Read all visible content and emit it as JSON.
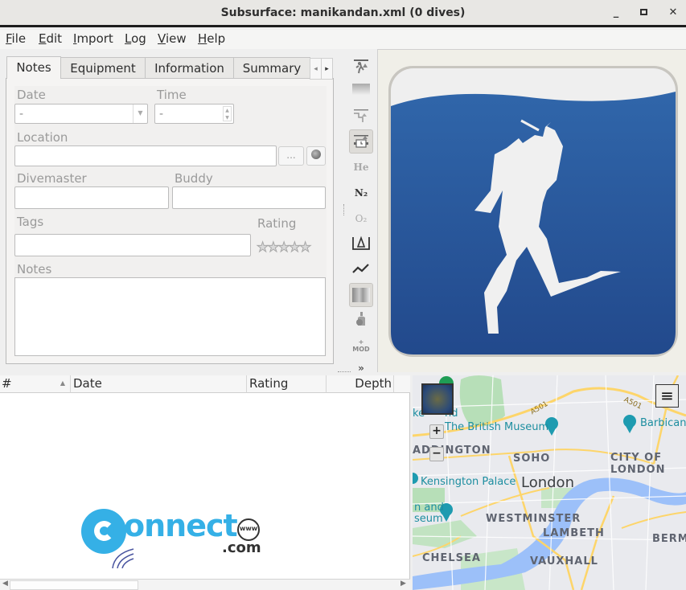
{
  "window": {
    "title": "Subsurface: manikandan.xml (0 dives)",
    "minimize_glyph": "_",
    "maximize_glyph": "□",
    "close_glyph": "✕"
  },
  "menu": {
    "items": [
      {
        "label": "File",
        "mnemonic": "F",
        "rest": "ile"
      },
      {
        "label": "Edit",
        "mnemonic": "E",
        "rest": "dit"
      },
      {
        "label": "Import",
        "mnemonic": "I",
        "rest": "mport"
      },
      {
        "label": "Log",
        "mnemonic": "L",
        "rest": "og"
      },
      {
        "label": "View",
        "mnemonic": "V",
        "rest": "iew"
      },
      {
        "label": "Help",
        "mnemonic": "H",
        "rest": "elp"
      }
    ]
  },
  "tabs": {
    "items": [
      {
        "label": "Notes",
        "active": true
      },
      {
        "label": "Equipment",
        "active": false
      },
      {
        "label": "Information",
        "active": false
      },
      {
        "label": "Summary",
        "active": false
      }
    ],
    "scroll_left": "◂",
    "scroll_right": "▸"
  },
  "notes_form": {
    "date_label": "Date",
    "date_value": "-",
    "time_label": "Time",
    "time_value": "-",
    "location_label": "Location",
    "location_value": "",
    "location_more_button": "...",
    "location_gps_icon": "globe-pin-icon",
    "divemaster_label": "Divemaster",
    "divemaster_value": "",
    "buddy_label": "Buddy",
    "buddy_value": "",
    "tags_label": "Tags",
    "tags_value": "",
    "rating_label": "Rating",
    "rating_stars": "★★★★★",
    "rating_value": 0,
    "rating_max": 5,
    "notes_label": "Notes",
    "notes_value": ""
  },
  "profile_toolbar": {
    "tools": [
      {
        "name": "ceiling-dc-icon",
        "text": "",
        "checked": false
      },
      {
        "name": "ceiling-gradient-icon",
        "text": "",
        "checked": false
      },
      {
        "name": "ceiling-calculated-icon",
        "text": "",
        "checked": false
      },
      {
        "name": "tissue-timer-icon",
        "text": "",
        "checked": true
      },
      {
        "name": "helium-icon",
        "text": "He",
        "checked": false
      },
      {
        "name": "nitrogen-icon",
        "text": "N₂",
        "checked": false
      },
      {
        "name": "oxygen-icon",
        "text": "O₂",
        "checked": false
      },
      {
        "name": "ruler-delta-icon",
        "text": "",
        "checked": false
      },
      {
        "name": "rate-graph-icon",
        "text": "",
        "checked": false
      },
      {
        "name": "heatmap-icon",
        "text": "",
        "checked": true
      },
      {
        "name": "tank-bar-icon",
        "text": "",
        "checked": false
      },
      {
        "name": "mod-icon",
        "text": "MOD",
        "checked": false
      },
      {
        "name": "more-chevron-icon",
        "text": "⌄",
        "checked": false
      }
    ]
  },
  "dive_list": {
    "columns": [
      {
        "label": "#",
        "sort": "▲"
      },
      {
        "label": "Date"
      },
      {
        "label": "Rating"
      },
      {
        "label": "Depth"
      }
    ],
    "rows": [],
    "watermark": {
      "main": "Connect",
      "sub": ".com",
      "www": "www"
    }
  },
  "map": {
    "labels": {
      "british_museum": "The British Museum",
      "barbican": "Barbican",
      "soho": "SOHO",
      "city": "CITY OF",
      "london_upper": "LONDON",
      "paddington": "ADDINGTON",
      "kensington_palace": "Kensington Palace",
      "london": "London",
      "museum_partial_1": "n and",
      "museum_partial_2": "seum",
      "westminster": "WESTMINSTER",
      "lambeth": "LAMBETH",
      "bermondsey": "BERM",
      "chelsea": "CHELSEA",
      "vauxhall": "VAUXHALL",
      "road_a501_1": "A501",
      "road_a501_2": "A501",
      "regents_partial": "ke",
      "regents_partial2": "nd"
    },
    "zoom_in": "+",
    "zoom_out": "−",
    "menu_glyph": "≡",
    "colors": {
      "land": "#e9eaee",
      "park": "#b7dfb8",
      "water": "#9cc0f9",
      "road": "#fdd56a",
      "poi": "#1e9bb0",
      "district_text": "#5f6470"
    }
  },
  "colors": {
    "logo_blue": "#2a5aa0",
    "logo_light": "#f0f0f0",
    "watermark_blue": "#35b0e6"
  }
}
